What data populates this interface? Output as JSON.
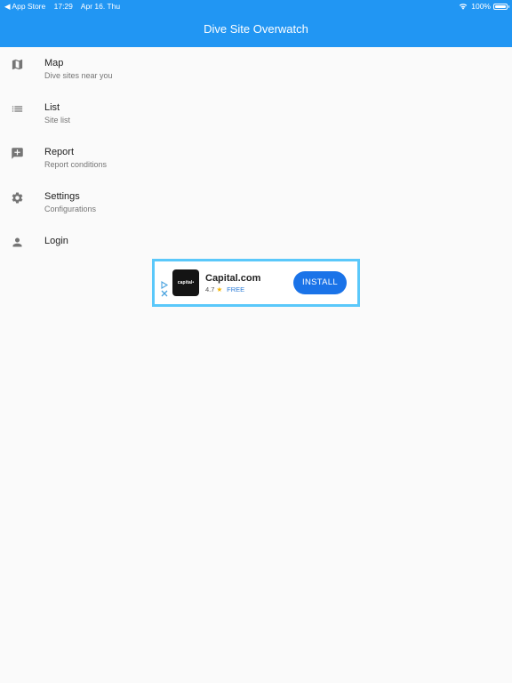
{
  "status_bar": {
    "back_app": "◀ App Store",
    "time": "17:29",
    "date": "Apr 16. Thu",
    "battery": "100%"
  },
  "app_bar": {
    "title": "Dive Site Overwatch",
    "background": "#2196f3"
  },
  "menu": {
    "items": [
      {
        "icon": "map-icon",
        "title": "Map",
        "subtitle": "Dive sites near you"
      },
      {
        "icon": "list-icon",
        "title": "List",
        "subtitle": "Site list"
      },
      {
        "icon": "add-comment-icon",
        "title": "Report",
        "subtitle": "Report conditions"
      },
      {
        "icon": "gear-icon",
        "title": "Settings",
        "subtitle": "Configurations"
      },
      {
        "icon": "person-icon",
        "title": "Login"
      }
    ]
  },
  "ad": {
    "logo_text": "capital•",
    "app_name": "Capital.com",
    "rating": "4.7",
    "star": "★",
    "price": "FREE",
    "install_label": "INSTALL",
    "border_color": "#5ac8fa",
    "button_color": "#1a73e8"
  }
}
